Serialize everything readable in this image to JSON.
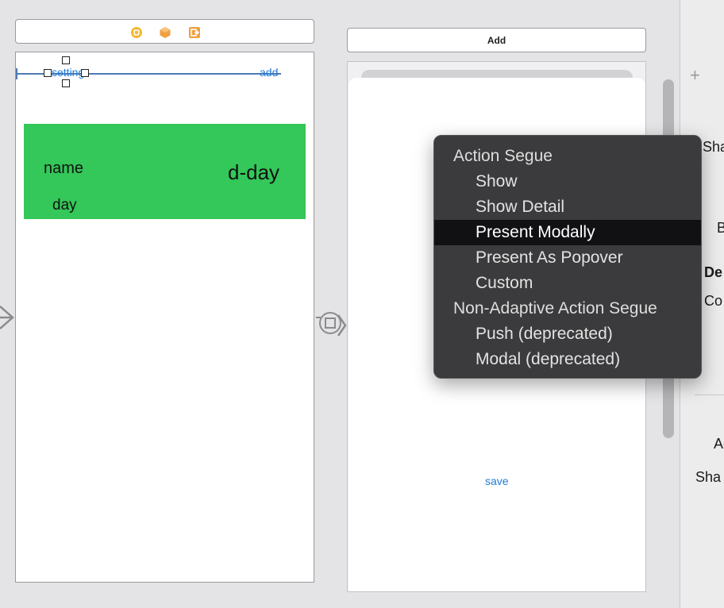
{
  "scene1": {
    "nav_left_label": "setting",
    "nav_right_label": "add",
    "cell": {
      "name_label": "name",
      "day_label": "day",
      "dday_label": "d-day"
    }
  },
  "scene2": {
    "top_button_label": "Add",
    "save_label": "save"
  },
  "segue_menu": {
    "sections": [
      {
        "title": "Action Segue",
        "items": [
          "Show",
          "Show Detail",
          "Present Modally",
          "Present As Popover",
          "Custom"
        ]
      },
      {
        "title": "Non-Adaptive Action Segue",
        "items": [
          "Push (deprecated)",
          "Modal (deprecated)"
        ]
      }
    ],
    "selected": "Present Modally"
  },
  "inspector": {
    "add_symbol": "+",
    "fragments": [
      "Sha",
      "B",
      "De",
      "Co",
      "Ac",
      "Sha"
    ]
  },
  "colors": {
    "cell_green": "#34c759",
    "link_blue": "#1f7bd6",
    "menu_bg": "#3b3b3d",
    "menu_selected": "#111113"
  }
}
